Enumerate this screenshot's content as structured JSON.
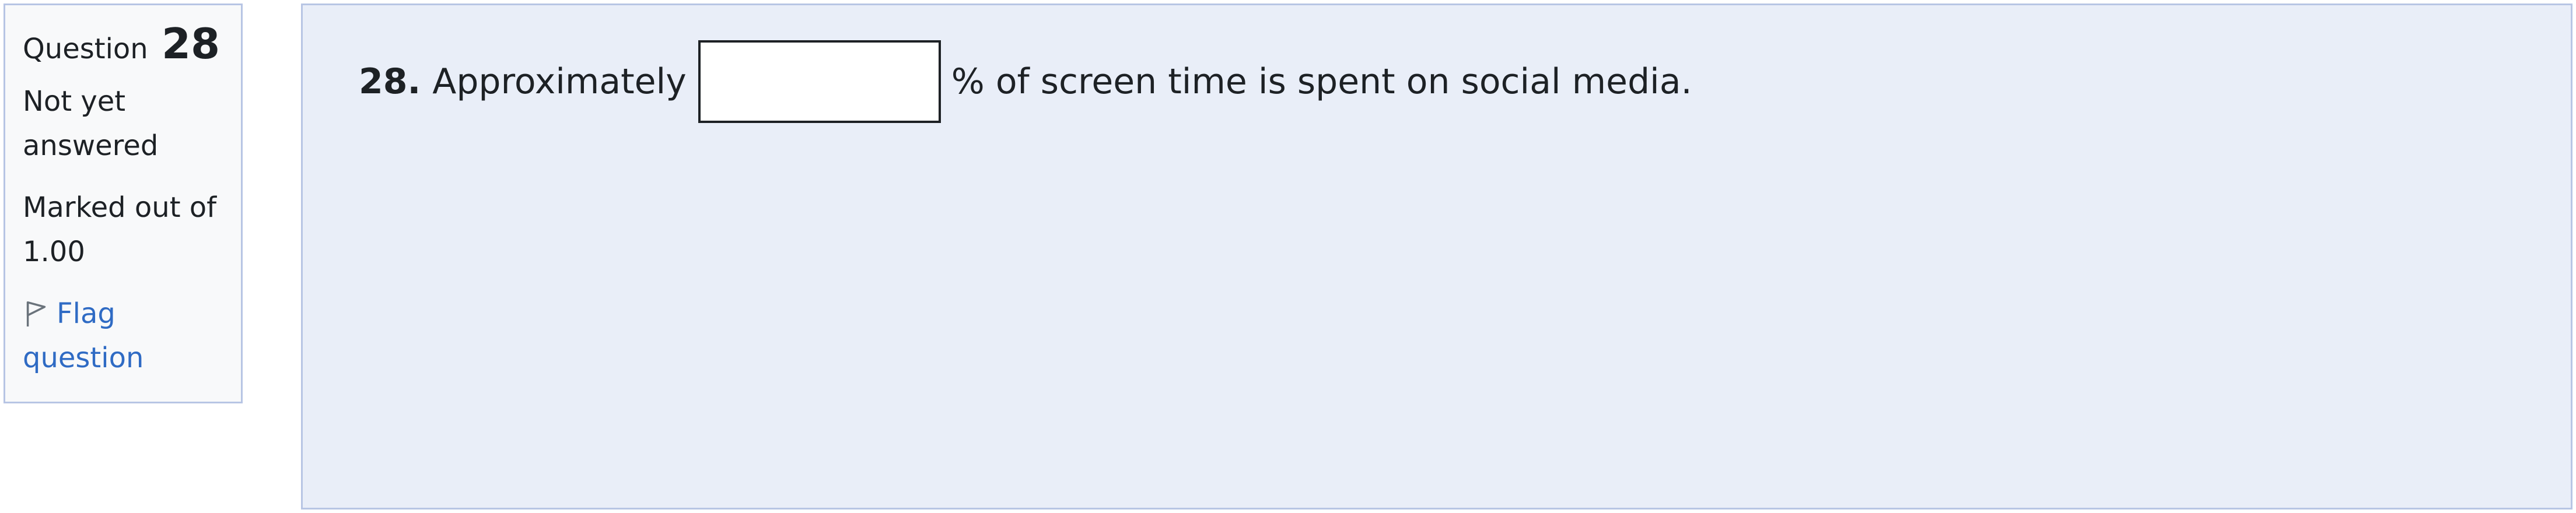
{
  "info": {
    "question_label": "Question",
    "question_number": "28",
    "state": "Not yet answered",
    "grade": "Marked out of 1.00",
    "flag_label": "Flag question"
  },
  "question": {
    "number": "28.",
    "text_before": "Approximately",
    "answer_value": "",
    "text_after": "% of screen time is spent on social media."
  },
  "colors": {
    "panel_background": "#f8f9fa",
    "content_background": "#e9eef8",
    "border": "#b7c5e4",
    "link": "#2f6bc4",
    "text": "#1d2125"
  },
  "icons": {
    "flag": "flag-icon"
  }
}
